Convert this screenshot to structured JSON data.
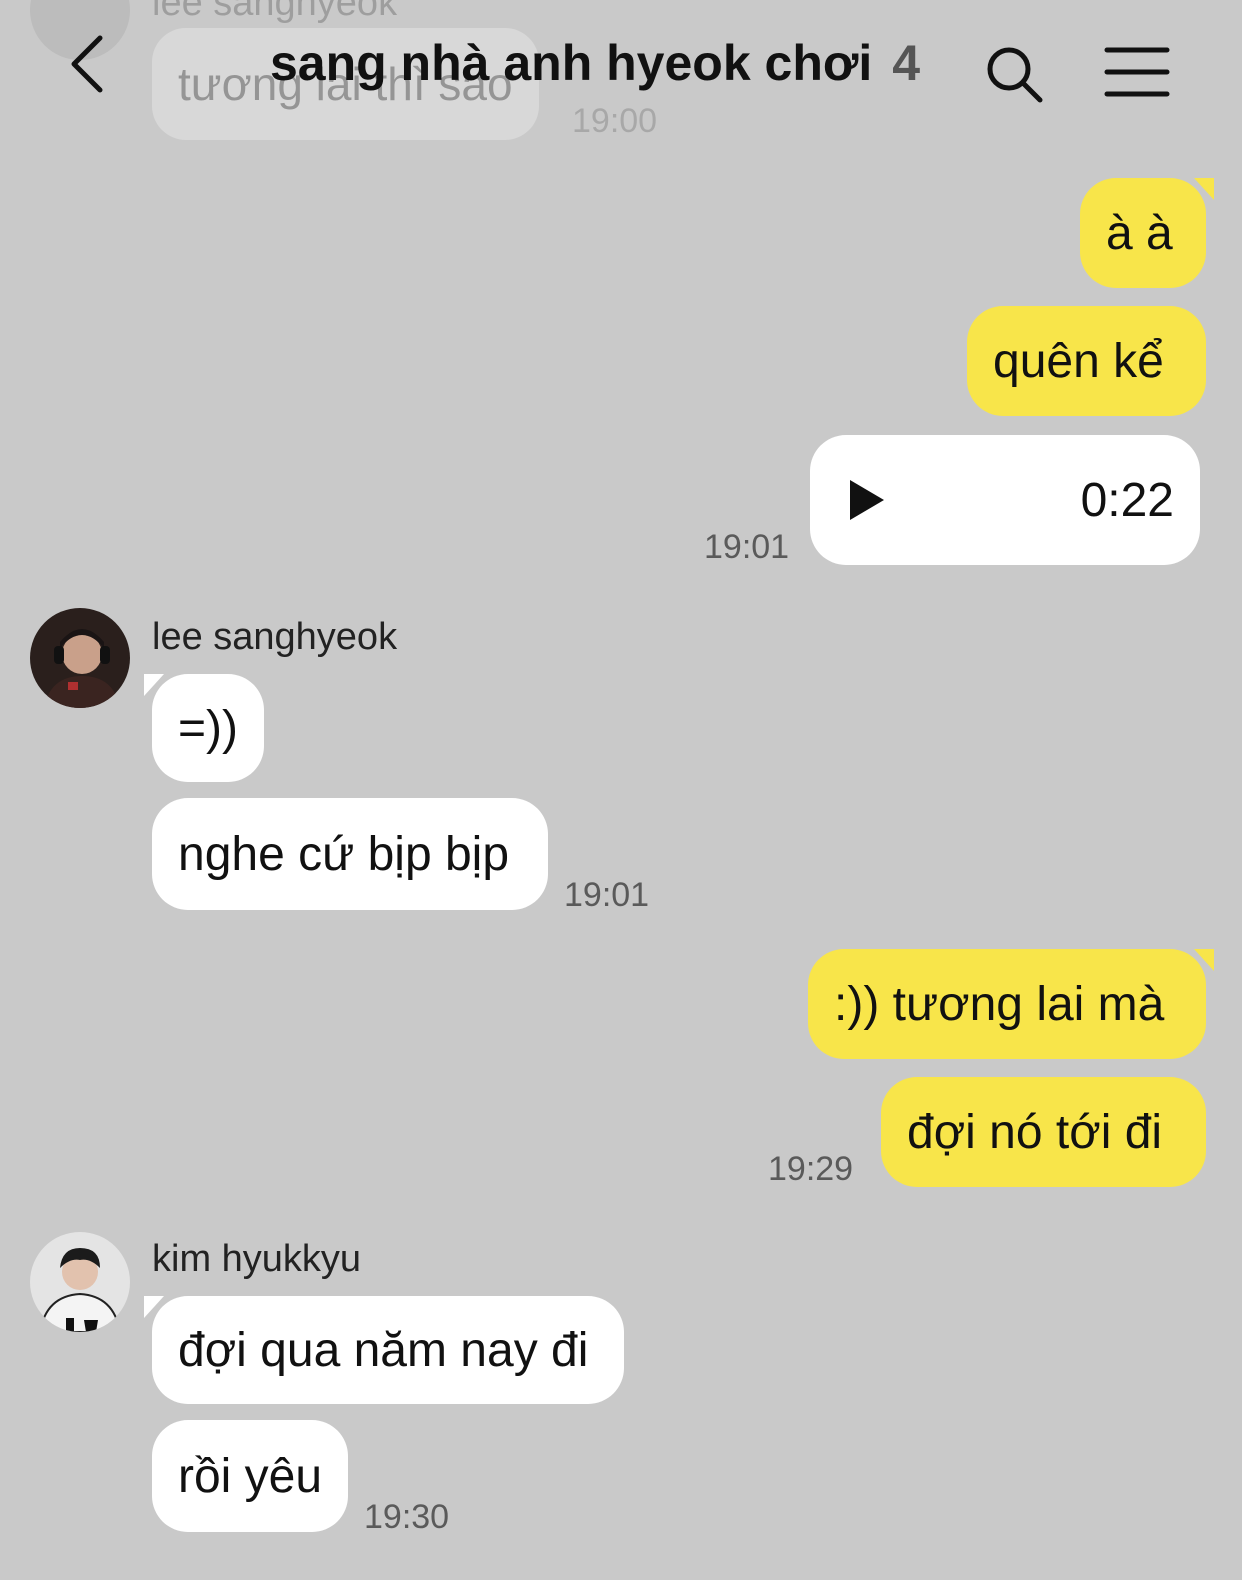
{
  "header": {
    "title": "sang nhà anh hyeok chơi",
    "member_count": "4"
  },
  "ghost": {
    "name": "lee sanghyeok",
    "message": "tương lai thì sao",
    "time": "19:00"
  },
  "messages": {
    "m1": "à à",
    "m2": "quên kể",
    "voice_duration": "0:22",
    "t1": "19:01",
    "user1_name": "lee sanghyeok",
    "m3": "=))",
    "m4": "nghe cứ bịp bịp",
    "t2": "19:01",
    "m5": ":)) tương lai mà",
    "m6": "đợi nó tới đi",
    "t3": "19:29",
    "user2_name": "kim hyukkyu",
    "m7": "đợi qua năm nay đi",
    "m8": "rồi yêu",
    "t4": "19:30"
  },
  "colors": {
    "background": "#c9c9c9",
    "my_bubble": "#f8e54a",
    "their_bubble": "#ffffff"
  }
}
